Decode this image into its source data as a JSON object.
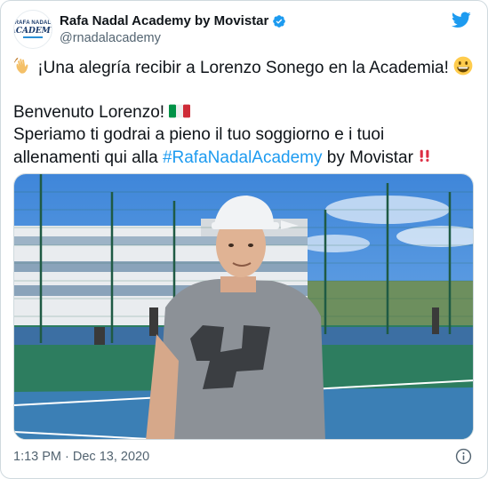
{
  "account": {
    "display_name": "Rafa Nadal Academy by Movistar",
    "handle": "@rnadalacademy",
    "avatar_logo_top": "RAFA NADAL",
    "avatar_logo_main": "ACADEMY"
  },
  "tweet": {
    "line1": "¡Una alegría recibir a Lorenzo Sonego en la Academia!",
    "line2": "Benvenuto Lorenzo!",
    "line3": "Speriamo ti godrai a pieno il tuo soggiorno e i tuoi",
    "line4_pre": "allenamenti qui alla ",
    "hashtag": "#RafaNadalAcademy",
    "line4_post": " by Movistar"
  },
  "footer": {
    "timestamp": "1:13 PM · Dec 13, 2020"
  },
  "colors": {
    "link": "#1d9bf0",
    "secondary_text": "#536471",
    "verified": "#1d9bf0"
  },
  "icons": [
    "verified-badge-icon",
    "twitter-bird-icon",
    "waving-hand-icon",
    "grinning-face-icon",
    "italy-flag-icon",
    "double-exclamation-icon",
    "info-icon"
  ]
}
